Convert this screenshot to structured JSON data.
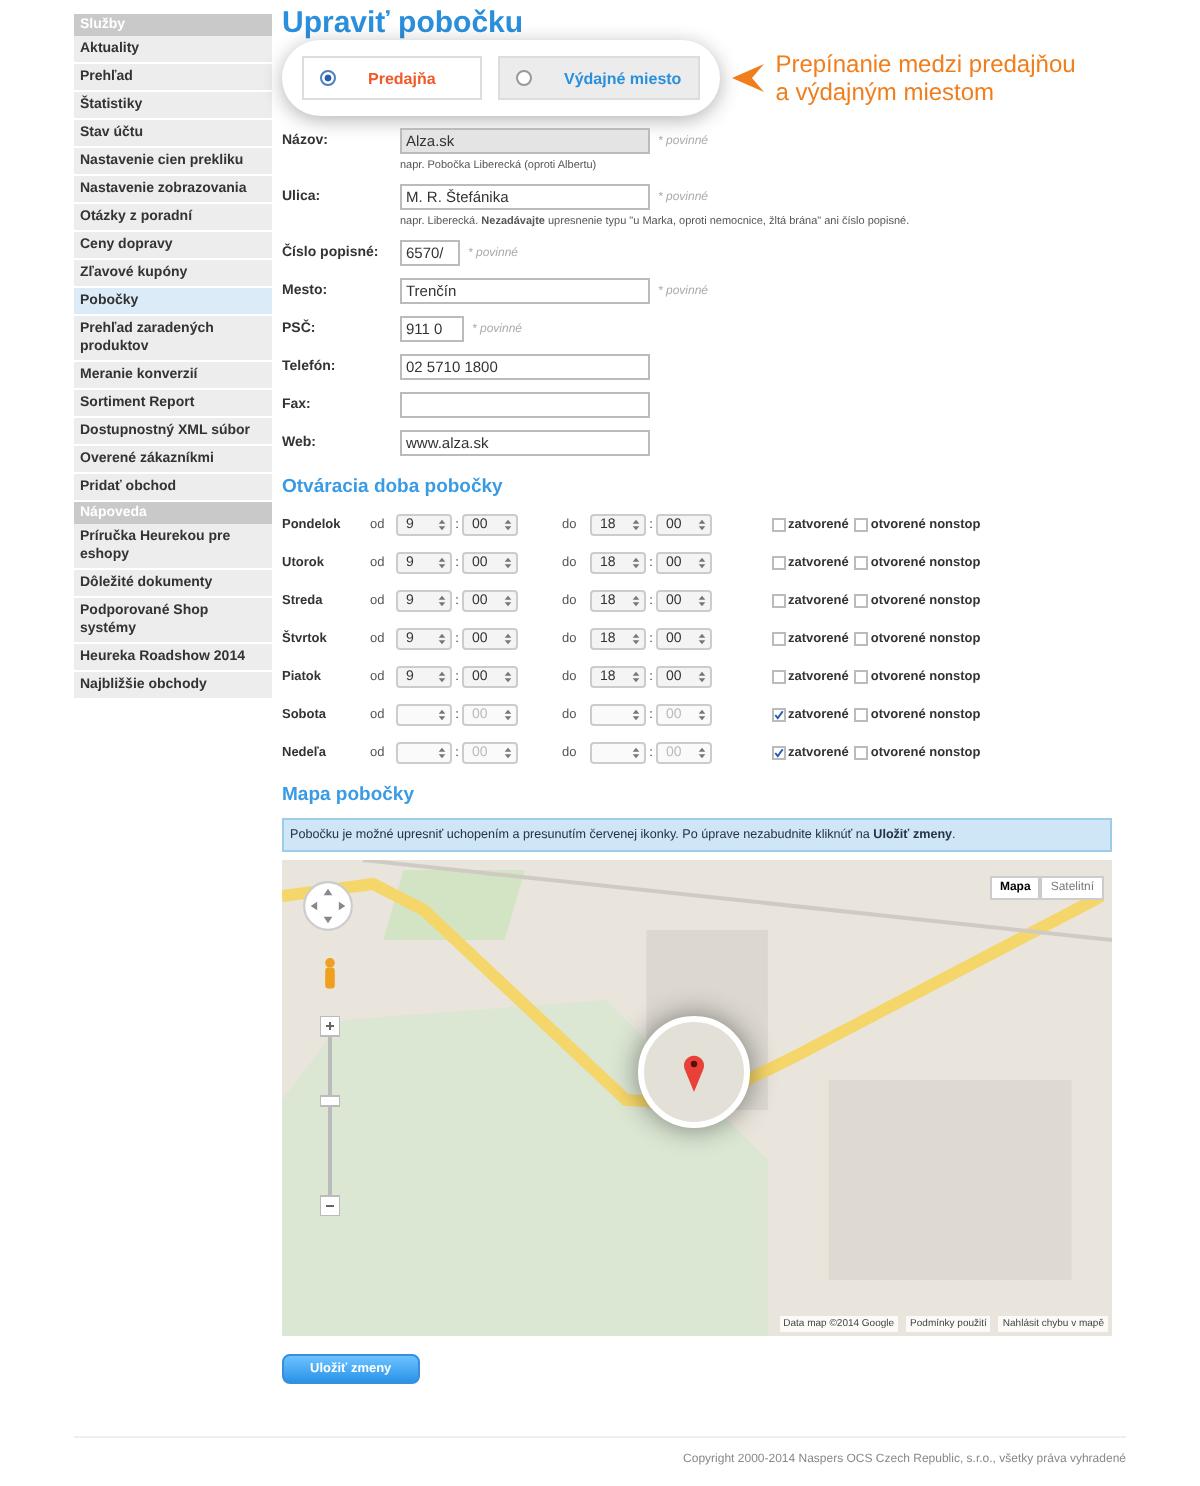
{
  "sidebar": {
    "sections": [
      {
        "title": "Služby",
        "items": [
          {
            "label": "Aktuality",
            "selected": false
          },
          {
            "label": "Prehľad",
            "selected": false
          },
          {
            "label": "Štatistiky",
            "selected": false
          },
          {
            "label": "Stav účtu",
            "selected": false
          },
          {
            "label": "Nastavenie cien prekliku",
            "selected": false
          },
          {
            "label": "Nastavenie zobrazovania",
            "selected": false
          },
          {
            "label": "Otázky z poradní",
            "selected": false
          },
          {
            "label": "Ceny dopravy",
            "selected": false
          },
          {
            "label": "Zľavové kupóny",
            "selected": false
          },
          {
            "label": "Pobočky",
            "selected": true
          },
          {
            "label": "Prehľad zaradených produktov",
            "selected": false
          },
          {
            "label": "Meranie konverzií",
            "selected": false
          },
          {
            "label": "Sortiment Report",
            "selected": false
          },
          {
            "label": "Dostupnostný XML súbor",
            "selected": false
          },
          {
            "label": "Overené zákazníkmi",
            "selected": false
          },
          {
            "label": "Pridať obchod",
            "selected": false
          }
        ]
      },
      {
        "title": "Nápoveda",
        "items": [
          {
            "label": "Príručka Heurekou pre eshopy",
            "selected": false
          },
          {
            "label": "Dôležité dokumenty",
            "selected": false
          },
          {
            "label": "Podporované Shop systémy",
            "selected": false
          },
          {
            "label": "Heureka Roadshow 2014",
            "selected": false
          },
          {
            "label": "Najbližšie obchody",
            "selected": false
          }
        ]
      }
    ]
  },
  "page_title": "Upraviť pobočku",
  "type_tabs": [
    {
      "label": "Predajňa",
      "selected": true
    },
    {
      "label": "Výdajné miesto",
      "selected": false
    }
  ],
  "annotation": "Prepínanie medzi predajňou a výdajným miestom",
  "form": {
    "fields": [
      {
        "label": "Názov:",
        "value": "Alza.sk",
        "kind": "wide",
        "disabled": true,
        "note": "* povinné",
        "hint": "napr. Pobočka Liberecká (oproti Albertu)"
      },
      {
        "label": "Ulica:",
        "value": "M. R. Štefánika",
        "kind": "wide",
        "disabled": false,
        "note": "* povinné",
        "hint": "napr. Liberecká. **Nezadávajte** upresnenie typu \"u Marka, oproti nemocnice, žltá brána\" ani číslo popisné."
      },
      {
        "label": "Číslo popisné:",
        "value": "6570/",
        "kind": "short",
        "disabled": false,
        "note": "* povinné"
      },
      {
        "label": "Mesto:",
        "value": "Trenčín",
        "kind": "wide",
        "disabled": false,
        "note": "* povinné"
      },
      {
        "label": "PSČ:",
        "value": "911 0",
        "kind": "medium",
        "disabled": false,
        "note": "* povinné"
      },
      {
        "label": "Telefón:",
        "value": "02 5710 1800",
        "kind": "wide",
        "disabled": false
      },
      {
        "label": "Fax:",
        "kind": "wide",
        "disabled": false
      },
      {
        "label": "Web:",
        "value": "www.alza.sk",
        "kind": "wide",
        "disabled": false
      }
    ]
  },
  "hours": {
    "heading": "Otváracia doba pobočky",
    "rows": [
      {
        "day": "Pondelok",
        "from": "od",
        "from_h": "9",
        "sep1": ":",
        "from_m": "00",
        "to": "do",
        "to_h": "18",
        "sep2": ":",
        "to_m": "00",
        "closed": false,
        "closed_label": "zatvorené",
        "nonstop": false,
        "nonstop_label": "otvorené nonstop"
      },
      {
        "day": "Utorok",
        "from": "od",
        "from_h": "9",
        "sep1": ":",
        "from_m": "00",
        "to": "do",
        "to_h": "18",
        "sep2": ":",
        "to_m": "00",
        "closed": false,
        "closed_label": "zatvorené",
        "nonstop": false,
        "nonstop_label": "otvorené nonstop"
      },
      {
        "day": "Streda",
        "from": "od",
        "from_h": "9",
        "sep1": ":",
        "from_m": "00",
        "to": "do",
        "to_h": "18",
        "sep2": ":",
        "to_m": "00",
        "closed": false,
        "closed_label": "zatvorené",
        "nonstop": false,
        "nonstop_label": "otvorené nonstop"
      },
      {
        "day": "Štvrtok",
        "from": "od",
        "from_h": "9",
        "sep1": ":",
        "from_m": "00",
        "to": "do",
        "to_h": "18",
        "sep2": ":",
        "to_m": "00",
        "closed": false,
        "closed_label": "zatvorené",
        "nonstop": false,
        "nonstop_label": "otvorené nonstop"
      },
      {
        "day": "Piatok",
        "from": "od",
        "from_h": "9",
        "sep1": ":",
        "from_m": "00",
        "to": "do",
        "to_h": "18",
        "sep2": ":",
        "to_m": "00",
        "closed": false,
        "closed_label": "zatvorené",
        "nonstop": false,
        "nonstop_label": "otvorené nonstop"
      },
      {
        "day": "Sobota",
        "from": "od",
        "sep1": ":",
        "from_m": "00",
        "to": "do",
        "sep2": ":",
        "to_m": "00",
        "closed": true,
        "closed_label": "zatvorené",
        "nonstop": false,
        "nonstop_label": "otvorené nonstop"
      },
      {
        "day": "Nedeľa",
        "from": "od",
        "sep1": ":",
        "from_m": "00",
        "to": "do",
        "sep2": ":",
        "to_m": "00",
        "closed": true,
        "closed_label": "zatvorené",
        "nonstop": false,
        "nonstop_label": "otvorené nonstop"
      }
    ]
  },
  "map": {
    "heading": "Mapa pobočky",
    "notice": "Pobočku je možné upresniť uchopením a presunutím červenej ikonky. Po úprave nezabudnite kliknúť na **Uložiť zmeny**.",
    "map_types": [
      {
        "label": "Mapa",
        "selected": true
      },
      {
        "label": "Satelitní",
        "selected": false
      }
    ],
    "attribution": [
      "Data map ©2014 Google",
      "Podmínky použití",
      "Nahlásit chybu v mapě"
    ]
  },
  "save_button": "Uložiť zmeny",
  "footer": "Copyright 2000-2014 Naspers OCS Czech Republic, s.r.o., všetky práva vyhradené"
}
